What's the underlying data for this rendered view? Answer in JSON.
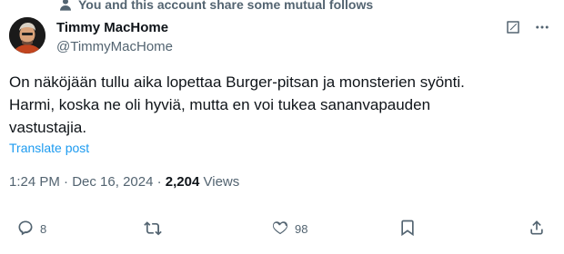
{
  "social_context": {
    "text": "You and this account share some mutual follows",
    "icon": "person-icon"
  },
  "author": {
    "display_name": "Timmy MacHome",
    "handle": "@TimmyMacHome",
    "avatar_icon": "avatar"
  },
  "header_icons": [
    "grok-icon",
    "more-icon"
  ],
  "post": {
    "text": "On näköjään tullu aika lopettaa Burger-pitsan ja monsterien syönti.\nHarmi, koska ne oli hyviä, mutta en voi tukea sananvapauden\nvastustajia.",
    "translate_label": "Translate post"
  },
  "meta": {
    "time": "1:24 PM",
    "separator": "·",
    "date": "Dec 16, 2024",
    "views_count": "2,204",
    "views_label": "Views"
  },
  "actions": {
    "replies": "8",
    "likes": "98",
    "icons": [
      "reply-icon",
      "repost-icon",
      "like-icon",
      "bookmark-icon",
      "share-icon"
    ]
  },
  "colors": {
    "accent": "#1d9bf0",
    "text": "#0f1419",
    "muted": "#536471"
  }
}
